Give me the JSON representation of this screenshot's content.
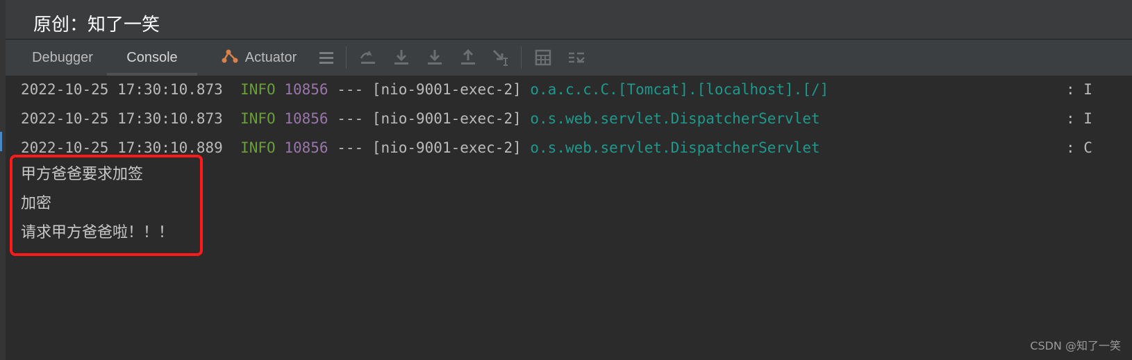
{
  "header": {
    "title": "原创：知了一笑"
  },
  "tabs": [
    {
      "label": "Debugger",
      "active": false
    },
    {
      "label": "Console",
      "active": true
    },
    {
      "label": "Actuator",
      "active": false
    }
  ],
  "toolbar_icons": [
    "menu-icon",
    "step-over-icon",
    "step-into-icon",
    "force-step-into-icon",
    "step-out-icon",
    "run-to-cursor-icon",
    "evaluate-expression-icon",
    "trace-icon"
  ],
  "log_lines": [
    {
      "timestamp": "2022-10-25 17:30:10.873",
      "level": "INFO",
      "pid": "10856",
      "sep": "---",
      "thread": "[nio-9001-exec-2]",
      "logger": "o.a.c.c.C.[Tomcat].[localhost].[/]",
      "tail": ": I"
    },
    {
      "timestamp": "2022-10-25 17:30:10.873",
      "level": "INFO",
      "pid": "10856",
      "sep": "---",
      "thread": "[nio-9001-exec-2]",
      "logger": "o.s.web.servlet.DispatcherServlet",
      "tail": ": I"
    },
    {
      "timestamp": "2022-10-25 17:30:10.889",
      "level": "INFO",
      "pid": "10856",
      "sep": "---",
      "thread": "[nio-9001-exec-2]",
      "logger": "o.s.web.servlet.DispatcherServlet",
      "tail": ": C"
    }
  ],
  "output_lines": [
    "甲方爸爸要求加签",
    "加密",
    "请求甲方爸爸啦！！！"
  ],
  "watermark": "CSDN @知了一笑",
  "colors": {
    "background": "#2b2b2b",
    "toolbar": "#3c3f41",
    "info": "#6a9e3a",
    "pid": "#9876aa",
    "logger": "#1d9a8c",
    "highlight": "#ff1a1a"
  }
}
